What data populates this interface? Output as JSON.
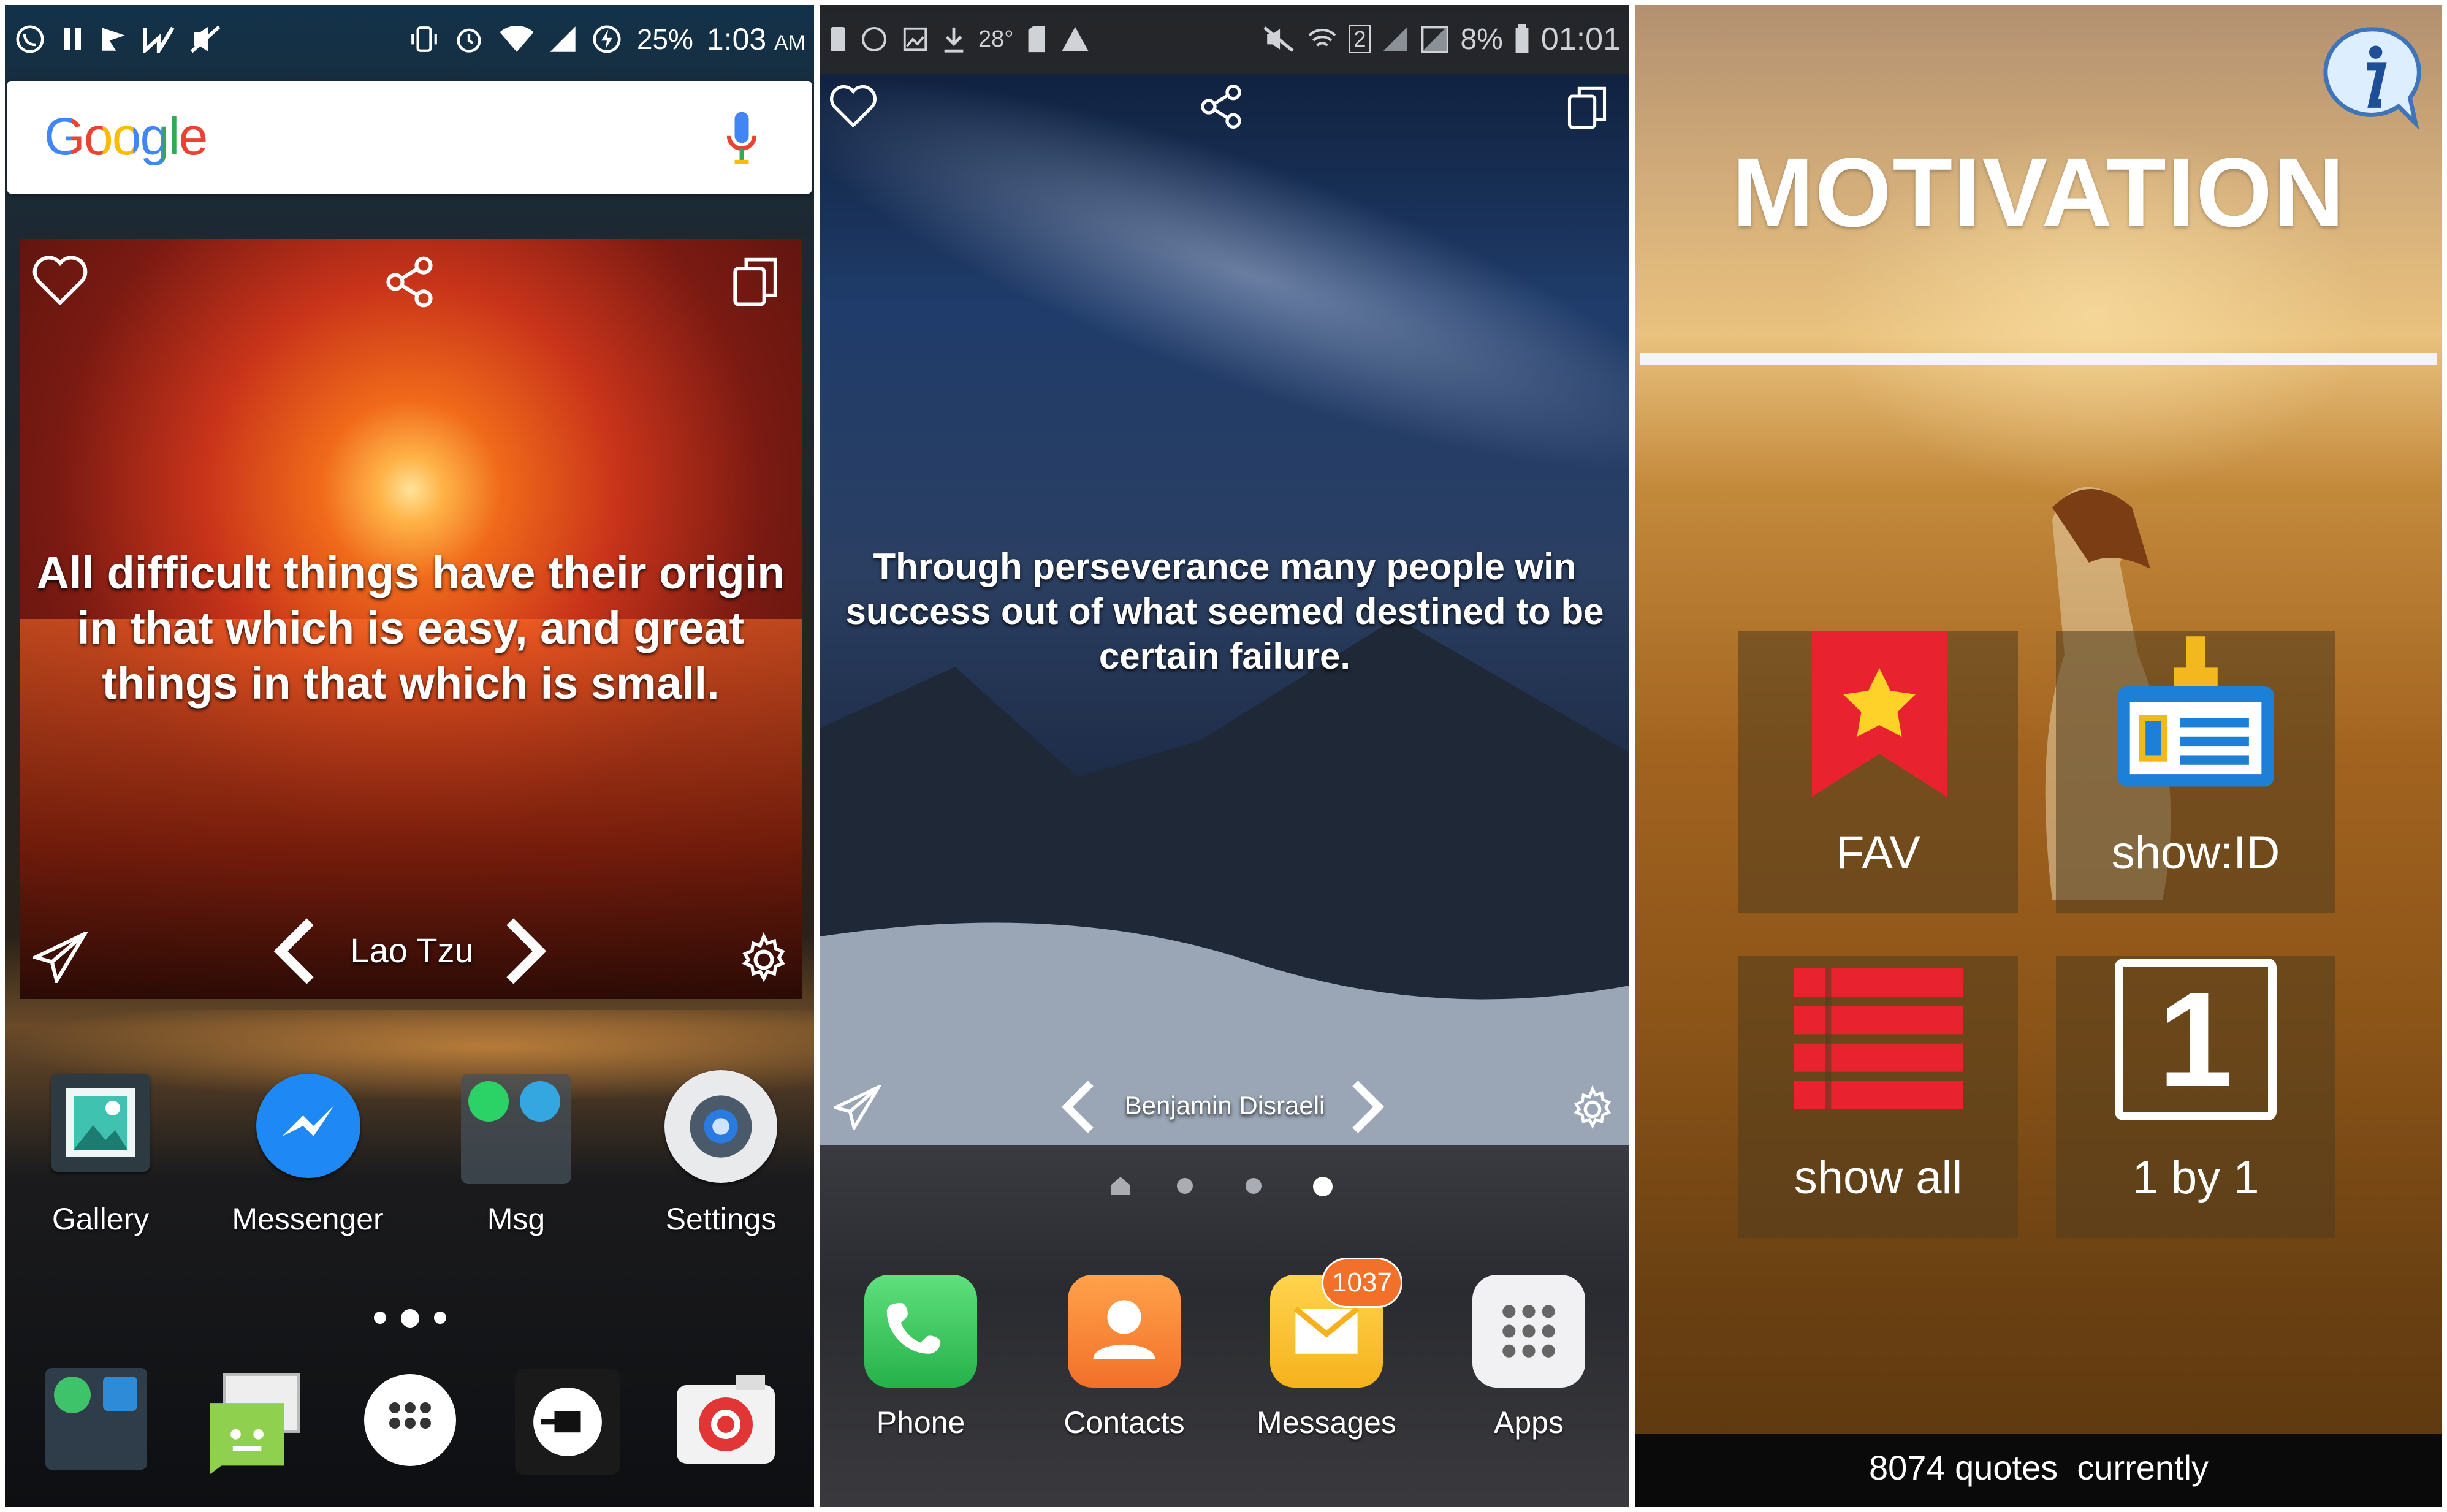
{
  "screen1": {
    "status_bar": {
      "battery": "25%",
      "time": "1:03",
      "ampm": "AM"
    },
    "search_logo": "Google",
    "widget_quote": "All difficult things have their origin in that which is easy, and great things in that which is small.",
    "widget_author": "Lao Tzu",
    "apps": [
      {
        "label": "Gallery"
      },
      {
        "label": "Messenger"
      },
      {
        "label": "Msg"
      },
      {
        "label": "Settings"
      }
    ]
  },
  "screen2": {
    "status_bar": {
      "temperature": "28°",
      "sim": "2",
      "battery": "8%",
      "time": "01:01"
    },
    "widget_quote": "Through perseverance many people win success out of what seemed destined to be certain failure.",
    "widget_author": "Benjamin Disraeli",
    "dock": [
      {
        "label": "Phone"
      },
      {
        "label": "Contacts"
      },
      {
        "label": "Messages",
        "badge": "1037"
      },
      {
        "label": "Apps"
      }
    ]
  },
  "screen3": {
    "title": "MOTIVATION",
    "tiles": [
      {
        "label": "FAV"
      },
      {
        "label": "show:ID"
      },
      {
        "label": "show all"
      },
      {
        "label": "1 by 1"
      }
    ],
    "id_digit": "1",
    "footer": "8074 quotes  currently"
  },
  "colors": {
    "google_blue": "#4285f4",
    "google_red": "#ea4335",
    "google_yellow": "#fbbc05",
    "google_green": "#34a853",
    "fav_red": "#e8222e",
    "idcard_blue": "#1e7fd6",
    "badge_orange": "#f2702a"
  }
}
